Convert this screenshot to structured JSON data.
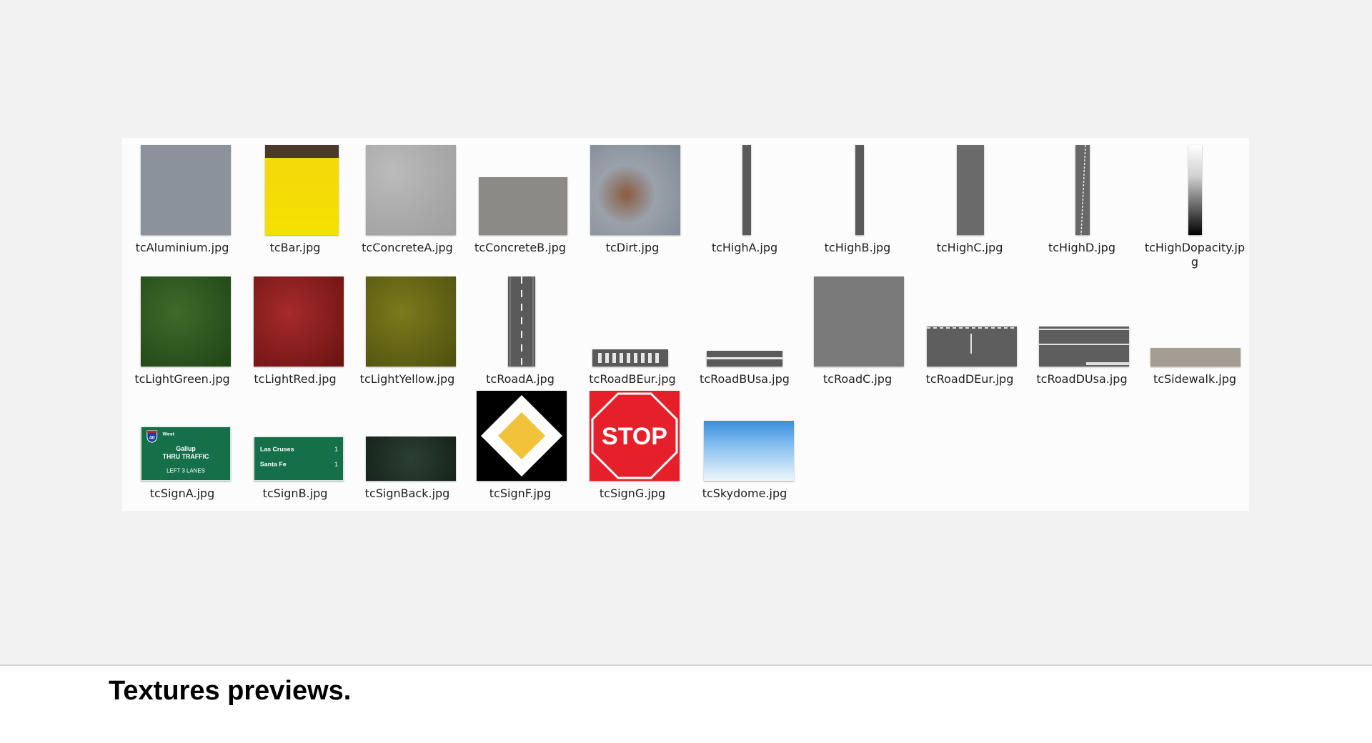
{
  "caption": "Textures previews.",
  "files": [
    {
      "name": "tcAluminium.jpg"
    },
    {
      "name": "tcBar.jpg"
    },
    {
      "name": "tcConcreteA.jpg"
    },
    {
      "name": "tcConcreteB.jpg"
    },
    {
      "name": "tcDirt.jpg"
    },
    {
      "name": "tcHighA.jpg"
    },
    {
      "name": "tcHighB.jpg"
    },
    {
      "name": "tcHighC.jpg"
    },
    {
      "name": "tcHighD.jpg"
    },
    {
      "name": "tcHighDopacity.jpg"
    },
    {
      "name": "tcLightGreen.jpg"
    },
    {
      "name": "tcLightRed.jpg"
    },
    {
      "name": "tcLightYellow.jpg"
    },
    {
      "name": "tcRoadA.jpg"
    },
    {
      "name": "tcRoadBEur.jpg"
    },
    {
      "name": "tcRoadBUsa.jpg"
    },
    {
      "name": "tcRoadC.jpg"
    },
    {
      "name": "tcRoadDEur.jpg"
    },
    {
      "name": "tcRoadDUsa.jpg"
    },
    {
      "name": "tcSidewalk.jpg"
    },
    {
      "name": "tcSignA.jpg"
    },
    {
      "name": "tcSignB.jpg"
    },
    {
      "name": "tcSignBack.jpg"
    },
    {
      "name": "tcSignF.jpg"
    },
    {
      "name": "tcSignG.jpg"
    },
    {
      "name": "tcSkydome.jpg"
    }
  ],
  "sign_text": {
    "signA_shield": "40",
    "signA_direction": "West",
    "signA_city": "Gallup",
    "signA_line2": "THRU TRAFFIC",
    "signA_line3": "LEFT 3 LANES",
    "signB_row1_city": "Las Cruses",
    "signB_row1_dist": "1",
    "signB_row2_city": "Santa Fe",
    "signB_row2_dist": "1",
    "signG_word": "STOP"
  }
}
